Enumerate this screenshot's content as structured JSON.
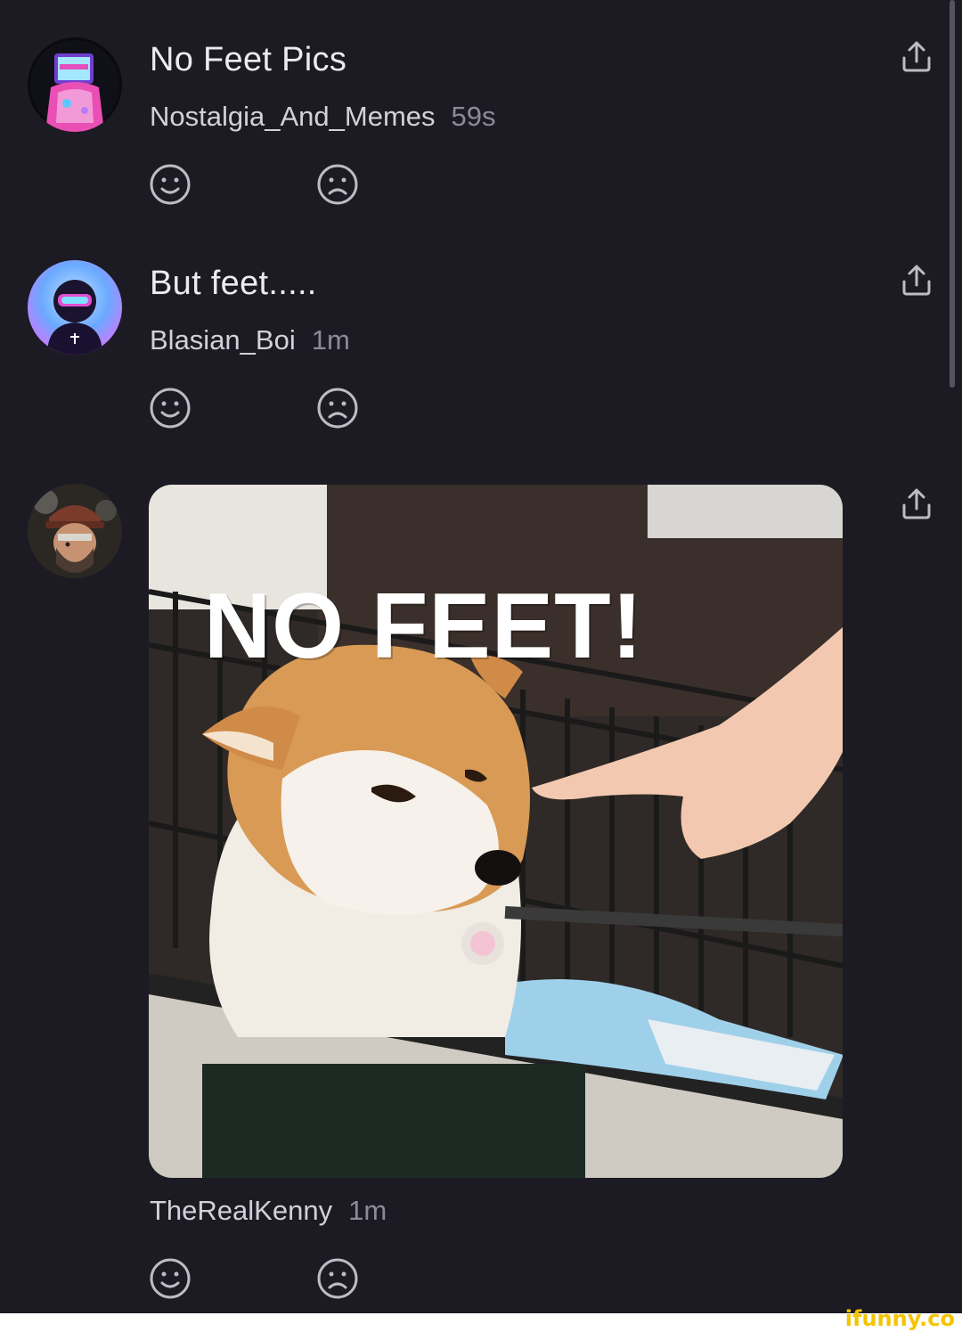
{
  "comments": [
    {
      "text": "No Feet Pics",
      "username": "Nostalgia_And_Memes",
      "time": "59s",
      "avatar_icon": "neon-tv-head-avatar"
    },
    {
      "text": "But feet.....",
      "username": "Blasian_Boi",
      "time": "1m",
      "avatar_icon": "masked-figure-avatar"
    },
    {
      "username": "TheRealKenny",
      "time": "1m",
      "avatar_icon": "bearded-man-avatar",
      "meme": {
        "caption": "NO FEET!",
        "description_icon": "shiba-dog-with-pointing-hand"
      }
    }
  ],
  "icons": {
    "upvote": "smile-icon",
    "downvote": "frown-icon",
    "share": "share-icon"
  },
  "watermark": "ifunny.co",
  "colors": {
    "background": "#1c1b24",
    "text": "#ecebf1",
    "muted": "#8d8b98",
    "watermark": "#f5c400"
  }
}
